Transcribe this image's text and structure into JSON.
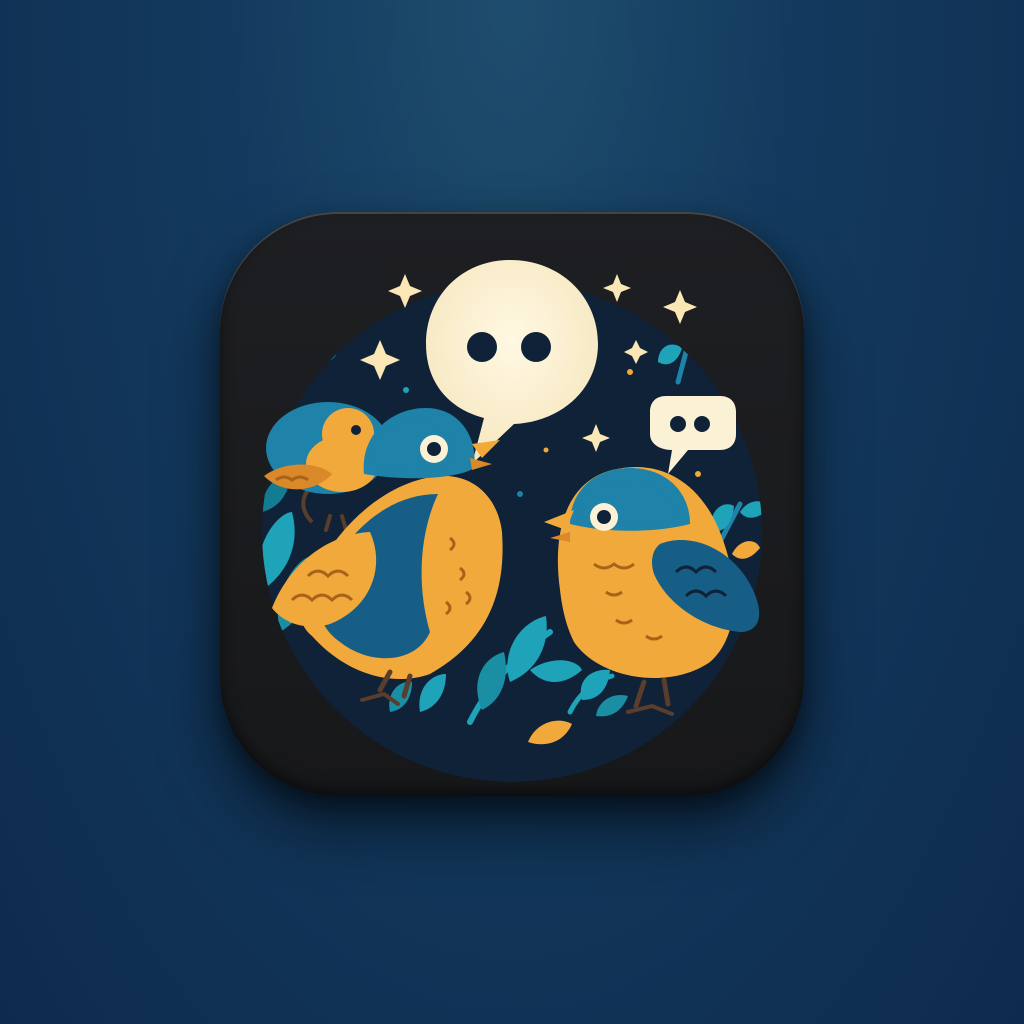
{
  "icon": {
    "theme": "chat-birds",
    "colors": {
      "background_top": "#1f4d6e",
      "background_bottom": "#0e2b4d",
      "tile": "#1b1c1f",
      "scene_backdrop": "#0f2238",
      "bird_blue": "#1f82a8",
      "bird_blue_dark": "#175e86",
      "bird_orange": "#f2a93b",
      "bird_orange_dark": "#d9882a",
      "leaf_teal": "#1fa3b8",
      "bubble_cream": "#fbf1d4",
      "sparkle": "#fbe7b5"
    },
    "elements": {
      "large_bubble": "speech-bubble-icon",
      "small_bubble": "speech-bubble-icon",
      "birds": [
        "bird-icon",
        "bird-icon",
        "bird-icon"
      ],
      "sparkles": "sparkle-icon",
      "leaves": "leaf-icon"
    }
  }
}
